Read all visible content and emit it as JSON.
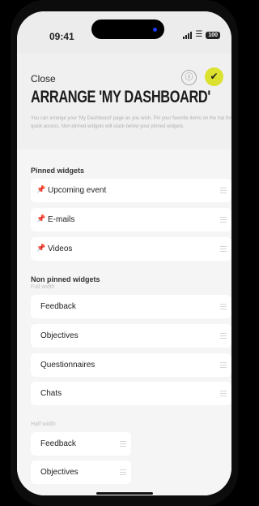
{
  "status": {
    "time": "09:41",
    "battery": "100"
  },
  "header": {
    "close_label": "Close",
    "info_icon": "ⓘ",
    "confirm_icon": "✔",
    "title": "ARRANGE 'MY DASHBOARD'",
    "description": "You can arrange your 'My Dashboard' page as you wish. Pin your favorite items on the top for quick access. Non pinned widgets will stack below your pinned widgets."
  },
  "pinned": {
    "title": "Pinned widgets",
    "items": [
      {
        "label": "Upcoming event"
      },
      {
        "label": "E-mails"
      },
      {
        "label": "Videos"
      }
    ]
  },
  "non_pinned": {
    "title": "Non pinned widgets",
    "full_width": {
      "subtitle": "Full width",
      "items": [
        {
          "label": "Feedback"
        },
        {
          "label": "Objectives"
        },
        {
          "label": "Questionnaires"
        },
        {
          "label": "Chats"
        }
      ]
    },
    "half_width": {
      "subtitle": "Half width",
      "items": [
        {
          "label": "Feedback"
        },
        {
          "label": "Objectives"
        }
      ]
    }
  },
  "colors": {
    "accent": "#dce02e",
    "pin": "#f0b73a"
  }
}
